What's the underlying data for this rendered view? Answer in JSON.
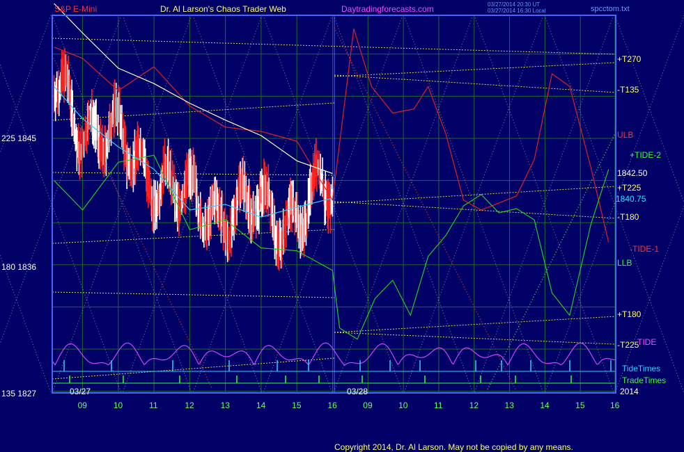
{
  "header": {
    "symbol": "S&P E-Mini",
    "title": "Dr. Al Larson's Chaos Trader Web",
    "site": "Daytradingforecasts.com",
    "time_line1": "03/27/2014 20:30 UT",
    "time_line2": "03/27/2014 16:30 Local",
    "file": "spcctom.txt"
  },
  "left_axis": [
    {
      "label": "225  1845",
      "price": 1845
    },
    {
      "label": "180  1836",
      "price": 1836
    },
    {
      "label": "135  1827",
      "price": 1827
    }
  ],
  "right_labels": [
    {
      "text": "+T270",
      "color": "#ffff66",
      "price": 1852.6
    },
    {
      "text": "-T135",
      "color": "#ffff66",
      "price": 1849.6
    },
    {
      "text": "ULB",
      "color": "#ff3333",
      "price": 1846.3
    },
    {
      "text": "+TIDE-2",
      "color": "#33ff33",
      "price": 1845.1
    },
    {
      "text": "1842.50",
      "color": "#ffffff",
      "price": 1842.5
    },
    {
      "text": "+T225",
      "color": "#ffff66",
      "price": 1841.4
    },
    {
      "text": "1840.75",
      "color": "#00ffff",
      "price": 1840.75
    },
    {
      "text": "-T180",
      "color": "#ffff66",
      "price": 1839.3
    },
    {
      "text": "-TIDE-1",
      "color": "#ff3333",
      "price": 1837.3
    },
    {
      "text": "LLB",
      "color": "#33ff33",
      "price": 1836.5
    },
    {
      "text": "+T180",
      "color": "#ffff66",
      "price": 1833.2
    },
    {
      "text": "-T225",
      "color": "#ffff66",
      "price": 1830.8
    },
    {
      "text": "TIDE",
      "color": "#ff44ff",
      "price": 1831.0
    }
  ],
  "bottom_labels": {
    "tidetimes": "TideTimes",
    "tradetimes": "TradeTimes",
    "date1": "03/27",
    "date2": "03/28",
    "year": "2014"
  },
  "hour_ticks": [
    "09",
    "10",
    "11",
    "12",
    "13",
    "14",
    "15",
    "16",
    "09",
    "10",
    "11",
    "12",
    "13",
    "14",
    "15",
    "16"
  ],
  "copyright": "Copyright 2014, Dr. Al Larson. May not be copied by any means.",
  "colors": {
    "background": "#000066",
    "plot_border": "#4466ff",
    "grid": "#1c6b2c",
    "price_up": "#ffffff",
    "price_down": "#ff2222",
    "upper_band": "#dd2222",
    "mid_green": "#22cc22",
    "cyan_avg": "#33ccff",
    "white_avg": "#ffffcc",
    "tide": "#cc44ff",
    "trend_lines": "#dddd44"
  },
  "chart_data": {
    "type": "line",
    "title": "S&P E-Mini",
    "ylim": [
      1827,
      1855
    ],
    "y_ticks": [
      1827,
      1836,
      1845
    ],
    "x_ticks": [
      "09",
      "10",
      "11",
      "12",
      "13",
      "14",
      "15",
      "16",
      "09",
      "10",
      "11",
      "12",
      "13",
      "14",
      "15",
      "16"
    ],
    "sessions": [
      "03/27",
      "03/28"
    ],
    "series": [
      {
        "name": "ULB",
        "x": [
          8.2,
          9.0,
          10.0,
          11.0,
          12.0,
          13.0,
          14.0,
          15.0,
          16.0,
          16.6,
          17.1,
          17.7,
          18.3,
          18.7,
          19.2,
          19.7,
          20.2,
          20.7,
          21.2,
          21.7,
          22.2,
          22.7,
          23.3,
          23.8
        ],
        "values": [
          1851.5,
          1850.7,
          1848.4,
          1850.1,
          1847.3,
          1845.8,
          1845.5,
          1844.8,
          1840.6,
          1852.8,
          1848.7,
          1846.8,
          1847.1,
          1848.7,
          1845.3,
          1840.6,
          1839.9,
          1840.4,
          1840.9,
          1843.5,
          1849.6,
          1848.7,
          1842.9,
          1837.6
        ]
      },
      {
        "name": "LLB",
        "x": [
          8.2,
          9.0,
          10.0,
          11.0,
          12.0,
          13.0,
          14.0,
          15.0,
          16.0,
          16.2,
          16.7,
          17.2,
          17.7,
          18.2,
          18.7,
          19.2,
          19.7,
          20.2,
          20.7,
          21.2,
          21.7,
          22.2,
          22.7,
          23.3,
          23.8
        ],
        "values": [
          1842.0,
          1839.9,
          1843.3,
          1843.8,
          1838.5,
          1839.2,
          1837.2,
          1837.0,
          1835.6,
          1831.5,
          1830.7,
          1833.6,
          1834.9,
          1832.4,
          1836.6,
          1838.1,
          1840.2,
          1841.0,
          1839.7,
          1840.0,
          1839.2,
          1834.0,
          1832.4,
          1838.9,
          1842.8
        ]
      },
      {
        "name": "white_avg",
        "x": [
          8.2,
          9.0,
          10.0,
          11.0,
          12.0,
          13.0,
          14.0,
          15.0,
          16.0
        ],
        "values": [
          1854.6,
          1852.5,
          1850.0,
          1848.9,
          1847.5,
          1846.3,
          1845.2,
          1843.4,
          1842.5
        ]
      },
      {
        "name": "cyan_avg",
        "x": [
          8.2,
          9.0,
          10.0,
          11.0,
          12.0,
          13.0,
          14.0,
          15.0,
          16.0
        ],
        "values": [
          1848.7,
          1846.4,
          1844.4,
          1842.8,
          1839.9,
          1840.3,
          1839.4,
          1840.1,
          1840.75
        ]
      }
    ]
  }
}
